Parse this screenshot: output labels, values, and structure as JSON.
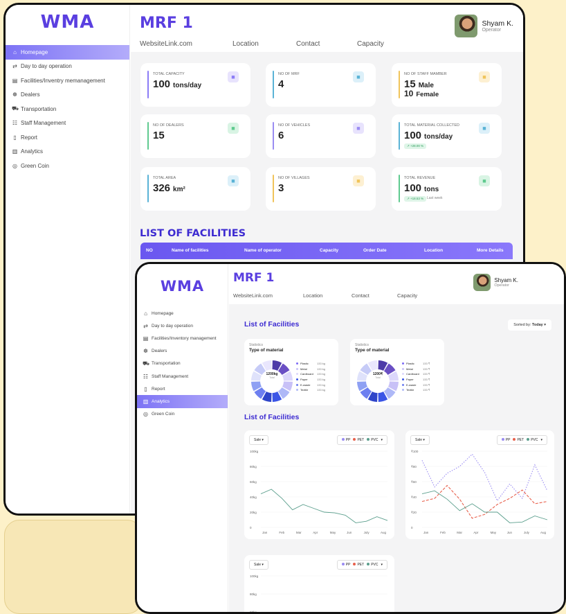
{
  "app": {
    "logo": "WMA",
    "title": "MRF 1",
    "links": [
      "WebsiteLink.com",
      "Location",
      "Contact",
      "Capacity"
    ]
  },
  "user": {
    "name": "Shyam K.",
    "role": "Operator"
  },
  "nav": [
    {
      "icon": "home-icon",
      "glyph": "⌂",
      "label": "Homepage"
    },
    {
      "icon": "transfer-icon",
      "glyph": "⇄",
      "label": "Day to day operation"
    },
    {
      "icon": "building-icon",
      "glyph": "▤",
      "label": "Facilities/Inventry memanagement"
    },
    {
      "icon": "dealers-icon",
      "glyph": "☸",
      "label": "Dealers"
    },
    {
      "icon": "truck-icon",
      "glyph": "⛟",
      "label": "Transportation"
    },
    {
      "icon": "staff-icon",
      "glyph": "☷",
      "label": "Staff Management"
    },
    {
      "icon": "report-icon",
      "glyph": "▯",
      "label": "Report"
    },
    {
      "icon": "analytics-icon",
      "glyph": "▥",
      "label": "Analytics"
    },
    {
      "icon": "coin-icon",
      "glyph": "◎",
      "label": "Green Coin"
    }
  ],
  "nav2_label": "Facilities/Inventory management",
  "stats": [
    {
      "label": "TOTAL CAPACITY",
      "value": "100",
      "unit": "tons/day",
      "color": "#8b7cf6",
      "icon": "factory-icon",
      "iconbg": "#e8e3fd"
    },
    {
      "label": "NO OF MRF",
      "value": "4",
      "unit": "",
      "color": "#5ab3d6",
      "icon": "plant-icon",
      "iconbg": "#dcf0f9"
    },
    {
      "label": "NO OF STAFF MAMBER",
      "value": "15",
      "unit": "Male",
      "value2": "10",
      "unit2": "Female",
      "color": "#f0c45a",
      "icon": "worker-icon",
      "iconbg": "#fdf0d2"
    },
    {
      "label": "NO OF DEALERS",
      "value": "15",
      "unit": "",
      "color": "#5fca8f",
      "icon": "person-icon",
      "iconbg": "#d9f4e4"
    },
    {
      "label": "NO OF VEHICLES",
      "value": "6",
      "unit": "",
      "color": "#9a8cf2",
      "icon": "vehicle-icon",
      "iconbg": "#e8e3fd"
    },
    {
      "label": "TOTAL MATERIAL COLLECTED",
      "value": "100",
      "unit": "tons/day",
      "badge": "↗ +28.00 %",
      "color": "#5ab3d6",
      "icon": "collector-icon",
      "iconbg": "#dcf0f9"
    },
    {
      "label": "TOTAL AREA",
      "value": "326",
      "unit": "km²",
      "color": "#5ab3d6",
      "icon": "pin-icon",
      "iconbg": "#dcf0f9"
    },
    {
      "label": "NO OF VILLAGES",
      "value": "3",
      "unit": "",
      "color": "#f0c45a",
      "icon": "village-icon",
      "iconbg": "#fdf0d2"
    },
    {
      "label": "TOTAL REVENUE",
      "value": "100",
      "unit": "tons",
      "badge": "↗ +18.53 %",
      "badge_note": "Last week",
      "color": "#5fca8f",
      "icon": "wallet-icon",
      "iconbg": "#d9f4e4"
    }
  ],
  "facilities": {
    "heading": "LIST OF FACILITIES",
    "columns": [
      "NO",
      "Name of facilities",
      "Name of operator",
      "Capacity",
      "Order Date",
      "Location",
      "More Details"
    ]
  },
  "analytics": {
    "heading": "List of Facilities",
    "heading2": "List of Facilities",
    "sort": "Sorted by:",
    "sort_value": "Today",
    "donuts": [
      {
        "small": "Statistics",
        "title": "Type of material",
        "center": "1200kg",
        "center_sub": "Total",
        "unit": "kg"
      },
      {
        "small": "Statistics",
        "title": "Type of material",
        "center": "1200₹",
        "center_sub": "Total",
        "unit": "₹"
      }
    ],
    "materials": [
      {
        "name": "Plastic",
        "color": "#7c6af5",
        "kg": "133 kg",
        "rs": "133 ₹"
      },
      {
        "name": "Metal",
        "color": "#c8c1f7",
        "kg": "133 kg",
        "rs": "133 ₹"
      },
      {
        "name": "Cardboard",
        "color": "#dcd7fb",
        "kg": "133 kg",
        "rs": "133 ₹"
      },
      {
        "name": "Paper",
        "color": "#3b55e6",
        "kg": "133 kg",
        "rs": "133 ₹"
      },
      {
        "name": "E-waste",
        "color": "#6d7ff0",
        "kg": "133 kg",
        "rs": "133 ₹"
      },
      {
        "name": "Textile",
        "color": "#aeb8f7",
        "kg": "133 kg",
        "rs": "133 ₹"
      }
    ],
    "chart_select": "Sale",
    "chart_legend": [
      "PP",
      "PET",
      "PVC"
    ],
    "legend_colors": [
      "#9a8cf2",
      "#e8604c",
      "#5a9e8c"
    ]
  },
  "chart_data": [
    {
      "type": "line",
      "x": [
        "Jan",
        "Feb",
        "Mar",
        "Apr",
        "May",
        "Jun",
        "July",
        "Aug"
      ],
      "ylim": [
        0,
        100
      ],
      "yticks": [
        "0",
        "20kg",
        "40kg",
        "60kg",
        "80kg",
        "100kg"
      ],
      "series": [
        {
          "name": "PVC",
          "values": [
            44,
            50,
            38,
            23,
            30,
            25,
            20,
            19,
            16,
            6,
            8,
            14,
            9
          ]
        }
      ],
      "legend": [
        "PP",
        "PET",
        "PVC"
      ]
    },
    {
      "type": "line",
      "x": [
        "Jan",
        "Feb",
        "Mar",
        "Apr",
        "May",
        "Jun",
        "July",
        "Aug"
      ],
      "ylim": [
        0,
        100
      ],
      "yticks": [
        "0",
        "₹20",
        "₹40",
        "₹60",
        "₹80",
        "₹100"
      ],
      "series": [
        {
          "name": "PP",
          "values": [
            88,
            53,
            71,
            80,
            96,
            72,
            35,
            57,
            38,
            82,
            48
          ]
        },
        {
          "name": "PET",
          "values": [
            34,
            38,
            55,
            37,
            12,
            17,
            30,
            38,
            49,
            31,
            34
          ]
        },
        {
          "name": "PVC",
          "values": [
            44,
            48,
            37,
            22,
            31,
            20,
            20,
            6,
            7,
            15,
            10
          ]
        }
      ],
      "legend": [
        "PP",
        "PET",
        "PVC"
      ]
    },
    {
      "type": "line",
      "x": [],
      "ylim": [
        0,
        100
      ],
      "yticks": [
        "100kg",
        "80kg",
        "60kg"
      ],
      "series": [],
      "legend": [
        "PP",
        "PET",
        "PVC"
      ]
    }
  ]
}
